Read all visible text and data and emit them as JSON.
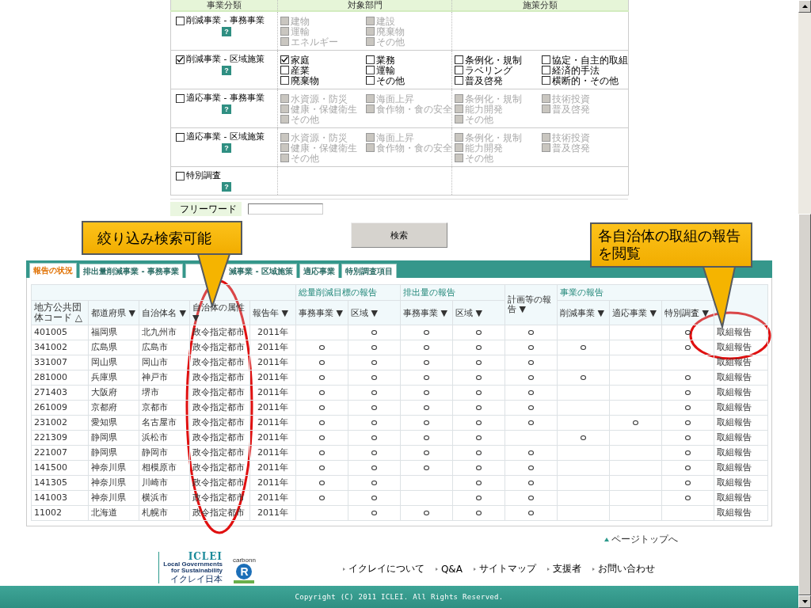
{
  "filter": {
    "columns": [
      "事業分類",
      "対象部門",
      "施策分類"
    ],
    "rows": [
      {
        "label": "削減事業 - 事務事業",
        "checked": false,
        "help": "?",
        "sectors": [
          {
            "label": "建物",
            "checked": false,
            "disabled": true
          },
          {
            "label": "建設",
            "checked": false,
            "disabled": true
          },
          {
            "label": "運輸",
            "checked": false,
            "disabled": true
          },
          {
            "label": "廃棄物",
            "checked": false,
            "disabled": true
          },
          {
            "label": "エネルギー",
            "checked": false,
            "disabled": true
          },
          {
            "label": "その他",
            "checked": false,
            "disabled": true
          }
        ],
        "measures": []
      },
      {
        "label": "削減事業 - 区域施策",
        "checked": true,
        "help": "?",
        "sectors": [
          {
            "label": "家庭",
            "checked": true,
            "disabled": false
          },
          {
            "label": "業務",
            "checked": false,
            "disabled": false
          },
          {
            "label": "産業",
            "checked": false,
            "disabled": false
          },
          {
            "label": "運輸",
            "checked": false,
            "disabled": false
          },
          {
            "label": "廃棄物",
            "checked": false,
            "disabled": false
          },
          {
            "label": "その他",
            "checked": false,
            "disabled": false
          }
        ],
        "measures": [
          {
            "label": "条例化・規制",
            "checked": false,
            "disabled": false
          },
          {
            "label": "協定・自主的取組",
            "checked": false,
            "disabled": false
          },
          {
            "label": "ラベリング",
            "checked": false,
            "disabled": false
          },
          {
            "label": "経済的手法",
            "checked": false,
            "disabled": false
          },
          {
            "label": "普及啓発",
            "checked": false,
            "disabled": false
          },
          {
            "label": "横断的・その他",
            "checked": false,
            "disabled": false
          }
        ]
      },
      {
        "label": "適応事業 - 事務事業",
        "checked": false,
        "help": "?",
        "sectors": [
          {
            "label": "水資源・防災",
            "checked": false,
            "disabled": true
          },
          {
            "label": "海面上昇",
            "checked": false,
            "disabled": true
          },
          {
            "label": "健康・保健衛生",
            "checked": false,
            "disabled": true
          },
          {
            "label": "食作物・食の安全",
            "checked": false,
            "disabled": true
          },
          {
            "label": "その他",
            "checked": false,
            "disabled": true
          }
        ],
        "measures": [
          {
            "label": "条例化・規制",
            "checked": false,
            "disabled": true
          },
          {
            "label": "技術投資",
            "checked": false,
            "disabled": true
          },
          {
            "label": "能力開発",
            "checked": false,
            "disabled": true
          },
          {
            "label": "普及啓発",
            "checked": false,
            "disabled": true
          },
          {
            "label": "その他",
            "checked": false,
            "disabled": true
          }
        ]
      },
      {
        "label": "適応事業 - 区域施策",
        "checked": false,
        "help": "?",
        "sectors": [
          {
            "label": "水資源・防災",
            "checked": false,
            "disabled": true
          },
          {
            "label": "海面上昇",
            "checked": false,
            "disabled": true
          },
          {
            "label": "健康・保健衛生",
            "checked": false,
            "disabled": true
          },
          {
            "label": "食作物・食の安全",
            "checked": false,
            "disabled": true
          },
          {
            "label": "その他",
            "checked": false,
            "disabled": true
          }
        ],
        "measures": [
          {
            "label": "条例化・規制",
            "checked": false,
            "disabled": true
          },
          {
            "label": "技術投資",
            "checked": false,
            "disabled": true
          },
          {
            "label": "能力開発",
            "checked": false,
            "disabled": true
          },
          {
            "label": "普及啓発",
            "checked": false,
            "disabled": true
          },
          {
            "label": "その他",
            "checked": false,
            "disabled": true
          }
        ]
      },
      {
        "label": "特別調査",
        "checked": false,
        "help": "?",
        "sectors": [],
        "measures": []
      }
    ]
  },
  "freeword": {
    "label": "フリーワード"
  },
  "search_button": "検索",
  "tabs": [
    {
      "label": "報告の状況",
      "selected": true
    },
    {
      "label": "排出量削減事業 - 事務事業",
      "selected": false
    },
    {
      "label": "減事業 - 区域施策",
      "selected": false
    },
    {
      "label": "適応事業",
      "selected": false
    },
    {
      "label": "特別調査項目",
      "selected": false
    }
  ],
  "table": {
    "header": [
      {
        "kind": "single",
        "label": "地方公共団体コード △"
      },
      {
        "kind": "single",
        "label": "都道府県 ▼"
      },
      {
        "kind": "single",
        "label": "自治体名 ▼"
      },
      {
        "kind": "single",
        "label": "自治体の属性 ▼"
      },
      {
        "kind": "single",
        "label": "報告年 ▼"
      },
      {
        "kind": "group",
        "label": "総量削減目標の報告",
        "columns": [
          "事務事業 ▼",
          "区域 ▼"
        ]
      },
      {
        "kind": "group",
        "label": "排出量の報告",
        "columns": [
          "事務事業 ▼",
          "区域 ▼"
        ]
      },
      {
        "kind": "tall",
        "label": "計画等の報告 ▼"
      },
      {
        "kind": "group",
        "label": "事業の報告",
        "columns": [
          "削減事業 ▼",
          "適応事業 ▼",
          "特別調査 ▼"
        ]
      },
      {
        "kind": "blank"
      }
    ],
    "rows": [
      {
        "code": "401005",
        "prefecture": "福岡県",
        "city": "北九州市",
        "type": "政令指定都市",
        "year": "2011年",
        "marks": [
          false,
          true,
          true,
          true,
          true,
          false,
          false,
          true
        ],
        "link": "取組報告"
      },
      {
        "code": "341002",
        "prefecture": "広島県",
        "city": "広島市",
        "type": "政令指定都市",
        "year": "2011年",
        "marks": [
          true,
          true,
          true,
          true,
          true,
          true,
          false,
          true
        ],
        "link": "取組報告"
      },
      {
        "code": "331007",
        "prefecture": "岡山県",
        "city": "岡山市",
        "type": "政令指定都市",
        "year": "2011年",
        "marks": [
          true,
          true,
          true,
          true,
          true,
          false,
          false,
          false
        ],
        "link": "取組報告"
      },
      {
        "code": "281000",
        "prefecture": "兵庫県",
        "city": "神戸市",
        "type": "政令指定都市",
        "year": "2011年",
        "marks": [
          true,
          true,
          true,
          true,
          true,
          true,
          false,
          true
        ],
        "link": "取組報告"
      },
      {
        "code": "271403",
        "prefecture": "大阪府",
        "city": "堺市",
        "type": "政令指定都市",
        "year": "2011年",
        "marks": [
          true,
          true,
          true,
          true,
          true,
          false,
          false,
          true
        ],
        "link": "取組報告"
      },
      {
        "code": "261009",
        "prefecture": "京都府",
        "city": "京都市",
        "type": "政令指定都市",
        "year": "2011年",
        "marks": [
          true,
          true,
          true,
          true,
          true,
          false,
          false,
          true
        ],
        "link": "取組報告"
      },
      {
        "code": "231002",
        "prefecture": "愛知県",
        "city": "名古屋市",
        "type": "政令指定都市",
        "year": "2011年",
        "marks": [
          true,
          true,
          true,
          true,
          true,
          false,
          true,
          true
        ],
        "link": "取組報告"
      },
      {
        "code": "221309",
        "prefecture": "静岡県",
        "city": "浜松市",
        "type": "政令指定都市",
        "year": "2011年",
        "marks": [
          true,
          true,
          true,
          true,
          false,
          true,
          false,
          true
        ],
        "link": "取組報告"
      },
      {
        "code": "221007",
        "prefecture": "静岡県",
        "city": "静岡市",
        "type": "政令指定都市",
        "year": "2011年",
        "marks": [
          true,
          true,
          true,
          true,
          true,
          false,
          false,
          true
        ],
        "link": "取組報告"
      },
      {
        "code": "141500",
        "prefecture": "神奈川県",
        "city": "相模原市",
        "type": "政令指定都市",
        "year": "2011年",
        "marks": [
          true,
          true,
          true,
          true,
          true,
          false,
          false,
          true
        ],
        "link": "取組報告"
      },
      {
        "code": "141305",
        "prefecture": "神奈川県",
        "city": "川崎市",
        "type": "政令指定都市",
        "year": "2011年",
        "marks": [
          true,
          true,
          false,
          true,
          true,
          false,
          false,
          true
        ],
        "link": "取組報告"
      },
      {
        "code": "141003",
        "prefecture": "神奈川県",
        "city": "横浜市",
        "type": "政令指定都市",
        "year": "2011年",
        "marks": [
          true,
          true,
          false,
          true,
          true,
          false,
          false,
          true
        ],
        "link": "取組報告"
      },
      {
        "code": "11002",
        "prefecture": "北海道",
        "city": "札幌市",
        "type": "政令指定都市",
        "year": "2011年",
        "marks": [
          false,
          true,
          true,
          true,
          true,
          false,
          false,
          false
        ],
        "link": "取組報告"
      }
    ]
  },
  "footer": {
    "page_top": "ページトップへ",
    "logo": {
      "name": "ICLEI",
      "subtitle": "Local Governments for Sustainability",
      "japanese": "イクレイ日本"
    },
    "badge": {
      "caption": "carbonn",
      "letter": "R"
    },
    "links": [
      "イクレイについて",
      "Q&A",
      "サイトマップ",
      "支援者",
      "お問い合わせ"
    ],
    "copyright": "Copyright (C) 2011 ICLEI. All Rights Reserved."
  },
  "callouts": [
    {
      "text": "絞り込み検索可能"
    },
    {
      "text": "各自治体の取組の報告を閲覧"
    }
  ]
}
